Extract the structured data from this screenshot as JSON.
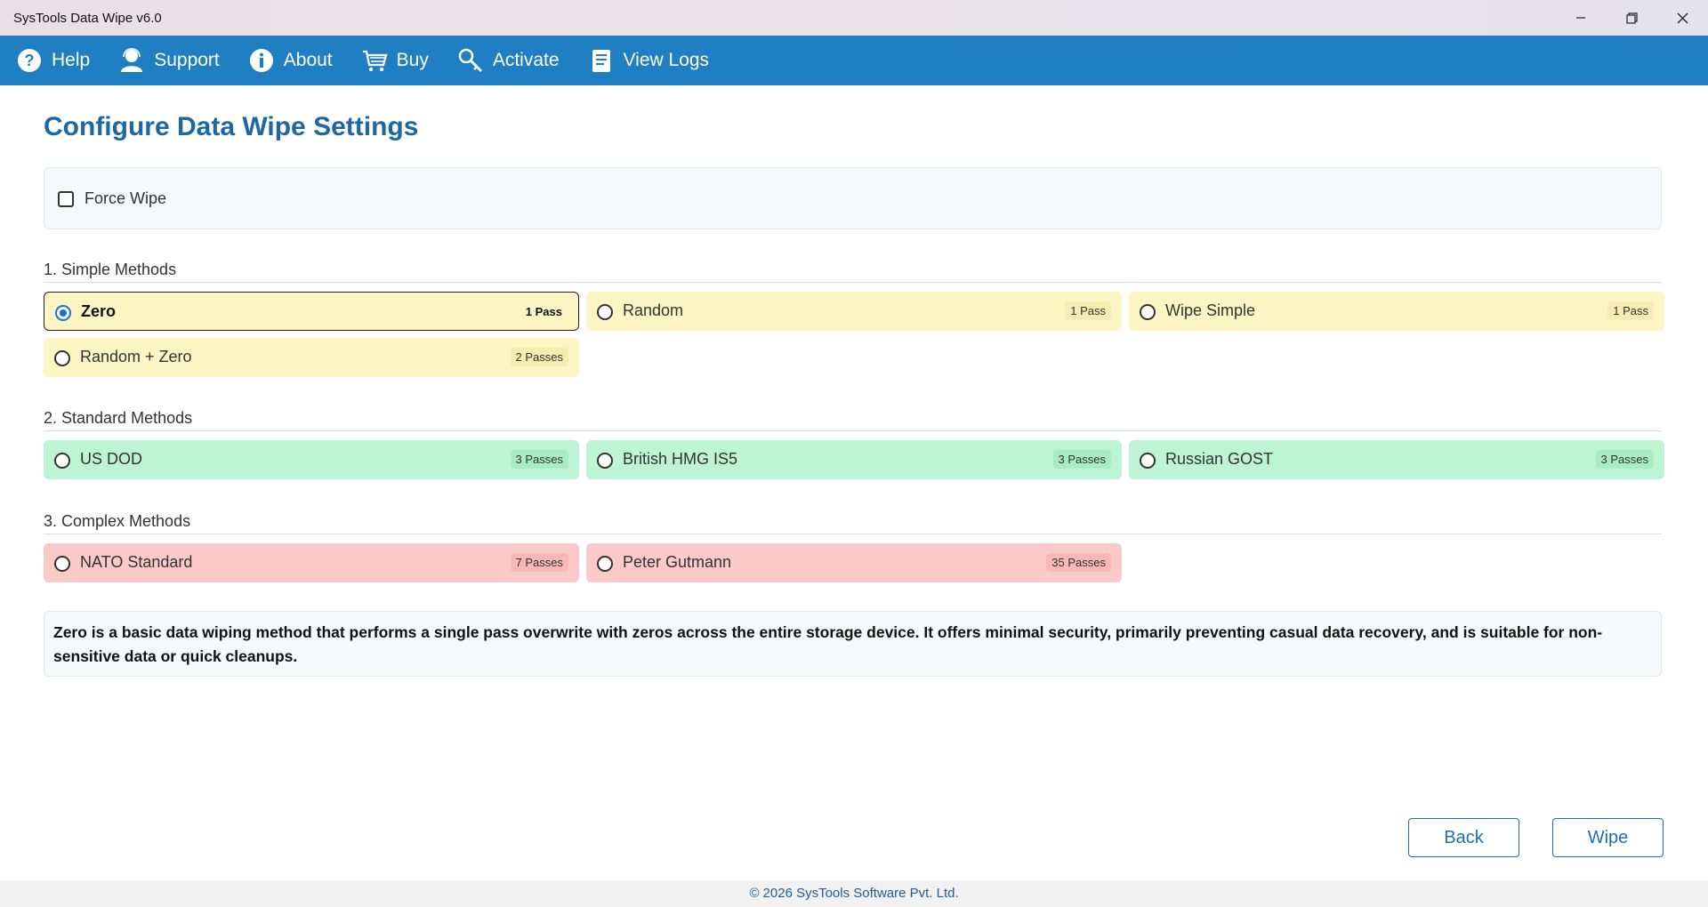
{
  "window": {
    "title": "SysTools Data Wipe v6.0"
  },
  "menu": [
    {
      "id": "help",
      "label": "Help",
      "icon": "help-icon"
    },
    {
      "id": "support",
      "label": "Support",
      "icon": "support-icon"
    },
    {
      "id": "about",
      "label": "About",
      "icon": "info-icon"
    },
    {
      "id": "buy",
      "label": "Buy",
      "icon": "cart-icon"
    },
    {
      "id": "activate",
      "label": "Activate",
      "icon": "key-icon"
    },
    {
      "id": "view-logs",
      "label": "View Logs",
      "icon": "logs-icon"
    }
  ],
  "page": {
    "title": "Configure Data Wipe Settings"
  },
  "force_wipe": {
    "label": "Force Wipe",
    "checked": false
  },
  "sections": [
    {
      "title": "1. Simple Methods"
    },
    {
      "title": "2. Standard Methods"
    },
    {
      "title": "3. Complex Methods"
    }
  ],
  "methods": {
    "zero": {
      "label": "Zero",
      "passes": "1 Pass",
      "selected": true
    },
    "random": {
      "label": "Random",
      "passes": "1 Pass"
    },
    "wipe_simple": {
      "label": "Wipe Simple",
      "passes": "1 Pass"
    },
    "random_zero": {
      "label": "Random + Zero",
      "passes": "2 Passes"
    },
    "us_dod": {
      "label": "US DOD",
      "passes": "3 Passes"
    },
    "british_hmg": {
      "label": "British HMG IS5",
      "passes": "3 Passes"
    },
    "russian_gost": {
      "label": "Russian GOST",
      "passes": "3 Passes"
    },
    "nato": {
      "label": "NATO Standard",
      "passes": "7 Passes"
    },
    "gutmann": {
      "label": "Peter Gutmann",
      "passes": "35 Passes"
    }
  },
  "colors": {
    "simple": "#fdf5c3",
    "standard": "#bdf5d3",
    "complex": "#fbc9c8",
    "accent": "#1f7fc2"
  },
  "description": "Zero is a basic data wiping method that performs a single pass overwrite with zeros across the entire storage device. It offers minimal security, primarily preventing casual data recovery, and is suitable for non-sensitive data or quick cleanups.",
  "buttons": {
    "back": "Back",
    "wipe": "Wipe"
  },
  "footer": {
    "text": "© 2026 SysTools Software Pvt. Ltd."
  }
}
